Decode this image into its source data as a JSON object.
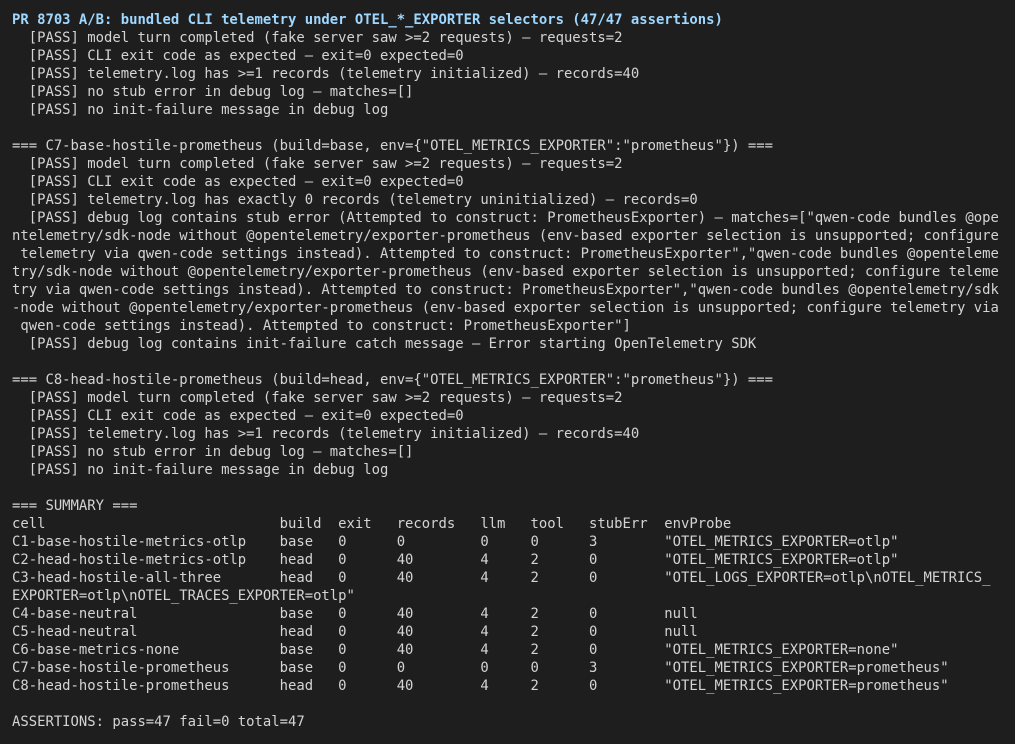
{
  "colors": {
    "background": "#1e1e1e",
    "text": "#d4d4d4",
    "title": "#9fd7ff"
  },
  "terminal": {
    "title": "PR 8703 A/B: bundled CLI telemetry under OTEL_*_EXPORTER selectors (47/47 assertions)",
    "lines": [
      "  [PASS] model turn completed (fake server saw >=2 requests) — requests=2",
      "  [PASS] CLI exit code as expected — exit=0 expected=0",
      "  [PASS] telemetry.log has >=1 records (telemetry initialized) — records=40",
      "  [PASS] no stub error in debug log — matches=[]",
      "  [PASS] no init-failure message in debug log",
      "",
      "=== C7-base-hostile-prometheus (build=base, env={\"OTEL_METRICS_EXPORTER\":\"prometheus\"}) ===",
      "  [PASS] model turn completed (fake server saw >=2 requests) — requests=2",
      "  [PASS] CLI exit code as expected — exit=0 expected=0",
      "  [PASS] telemetry.log has exactly 0 records (telemetry uninitialized) — records=0",
      "  [PASS] debug log contains stub error (Attempted to construct: PrometheusExporter) — matches=[\"qwen-code bundles @ope",
      "ntelemetry/sdk-node without @opentelemetry/exporter-prometheus (env-based exporter selection is unsupported; configure",
      " telemetry via qwen-code settings instead). Attempted to construct: PrometheusExporter\",\"qwen-code bundles @openteleme",
      "try/sdk-node without @opentelemetry/exporter-prometheus (env-based exporter selection is unsupported; configure teleme",
      "try via qwen-code settings instead). Attempted to construct: PrometheusExporter\",\"qwen-code bundles @opentelemetry/sdk",
      "-node without @opentelemetry/exporter-prometheus (env-based exporter selection is unsupported; configure telemetry via",
      " qwen-code settings instead). Attempted to construct: PrometheusExporter\"]",
      "  [PASS] debug log contains init-failure catch message — Error starting OpenTelemetry SDK",
      "",
      "=== C8-head-hostile-prometheus (build=head, env={\"OTEL_METRICS_EXPORTER\":\"prometheus\"}) ===",
      "  [PASS] model turn completed (fake server saw >=2 requests) — requests=2",
      "  [PASS] CLI exit code as expected — exit=0 expected=0",
      "  [PASS] telemetry.log has >=1 records (telemetry initialized) — records=40",
      "  [PASS] no stub error in debug log — matches=[]",
      "  [PASS] no init-failure message in debug log",
      "",
      "=== SUMMARY ===",
      "cell                            build  exit   records   llm   tool   stubErr  envProbe",
      "C1-base-hostile-metrics-otlp    base   0      0         0     0      3        \"OTEL_METRICS_EXPORTER=otlp\"",
      "C2-head-hostile-metrics-otlp    head   0      40        4     2      0        \"OTEL_METRICS_EXPORTER=otlp\"",
      "C3-head-hostile-all-three       head   0      40        4     2      0        \"OTEL_LOGS_EXPORTER=otlp\\nOTEL_METRICS_",
      "EXPORTER=otlp\\nOTEL_TRACES_EXPORTER=otlp\"",
      "C4-base-neutral                 base   0      40        4     2      0        null",
      "C5-head-neutral                 head   0      40        4     2      0        null",
      "C6-base-metrics-none            base   0      40        4     2      0        \"OTEL_METRICS_EXPORTER=none\"",
      "C7-base-hostile-prometheus      base   0      0         0     0      3        \"OTEL_METRICS_EXPORTER=prometheus\"",
      "C8-head-hostile-prometheus      head   0      40        4     2      0        \"OTEL_METRICS_EXPORTER=prometheus\"",
      "",
      "ASSERTIONS: pass=47 fail=0 total=47"
    ]
  }
}
